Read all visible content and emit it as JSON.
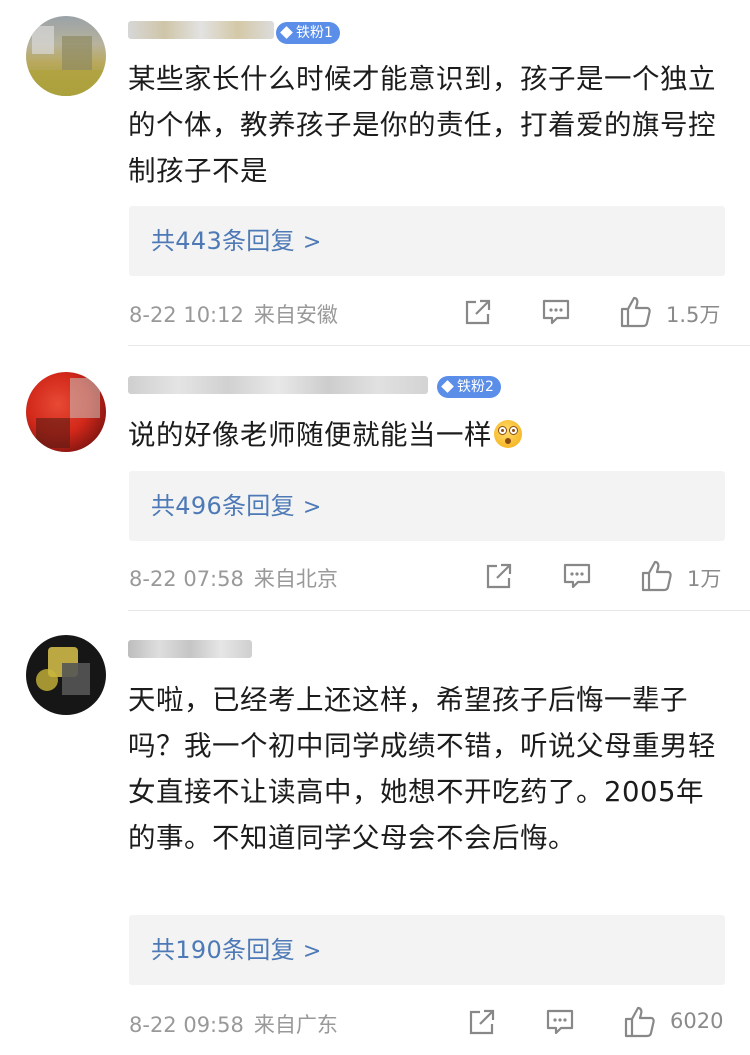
{
  "comments": [
    {
      "username_visible": "",
      "badge": "铁粉1",
      "text": "某些家长什么时候才能意识到，孩子是一个独立的个体，教养孩子是你的责任，打着爱的旗号控制孩子不是",
      "reply_link": "共443条回复",
      "date": "8-22 10:12",
      "location": "来自安徽",
      "likes": "1.5万"
    },
    {
      "username_visible": "",
      "badge": "铁粉2",
      "text": "说的好像老师随便就能当一样",
      "emoji": "astonished-emoji",
      "reply_link": "共496条回复",
      "date": "8-22 07:58",
      "location": "来自北京",
      "likes": "1万"
    },
    {
      "username_visible": "",
      "text": "天啦，已经考上还这样，希望孩子后悔一辈子吗？我一个初中同学成绩不错，听说父母重男轻女直接不让读高中，她想不开吃药了。2005年的事。不知道同学父母会不会后悔。",
      "reply_link": "共190条回复",
      "date": "8-22 09:58",
      "location": "来自广东",
      "likes": "6020"
    }
  ],
  "icons": {
    "repost": "share-icon",
    "comment": "comment-icon",
    "like": "thumbs-up-icon"
  },
  "colors": {
    "link": "#4d79b6",
    "meta": "#999999",
    "reply_bg": "#f3f3f3",
    "badge": "#5b8ee8"
  }
}
